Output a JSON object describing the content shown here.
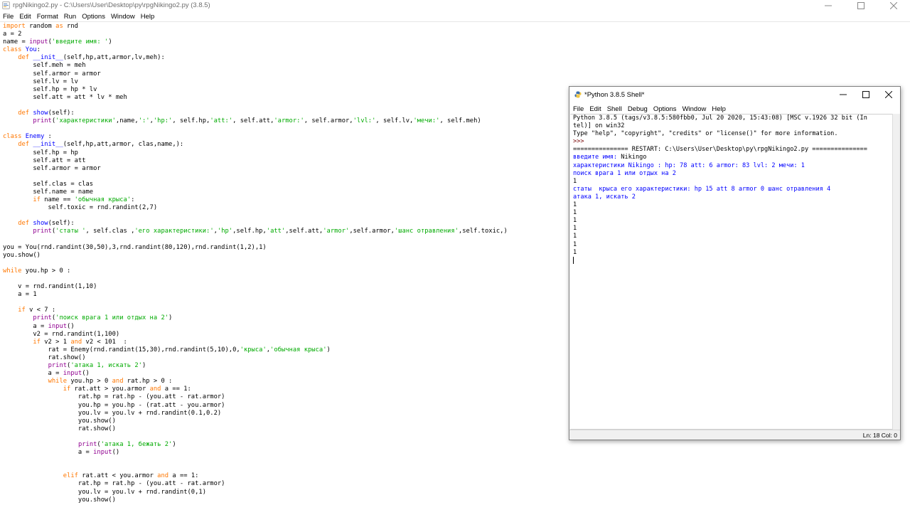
{
  "editor_window": {
    "title": "rpgNikingo2.py - C:\\Users\\User\\Desktop\\py\\rpgNikingo2.py (3.8.5)",
    "menu": [
      "File",
      "Edit",
      "Format",
      "Run",
      "Options",
      "Window",
      "Help"
    ],
    "code": [
      [
        [
          "kw",
          "import"
        ],
        [
          "t",
          " random "
        ],
        [
          "kw",
          "as"
        ],
        [
          "t",
          " rnd"
        ]
      ],
      [
        [
          "t",
          "a = 2"
        ]
      ],
      [
        [
          "t",
          "name = "
        ],
        [
          "bi",
          "input"
        ],
        [
          "t",
          "("
        ],
        [
          "st",
          "'введите имя: '"
        ],
        [
          "t",
          ")"
        ]
      ],
      [
        [
          "kw",
          "class"
        ],
        [
          "t",
          " "
        ],
        [
          "df",
          "You"
        ],
        [
          "t",
          ":"
        ]
      ],
      [
        [
          "t",
          "    "
        ],
        [
          "kw",
          "def"
        ],
        [
          "t",
          " "
        ],
        [
          "df",
          "__init__"
        ],
        [
          "t",
          "(self,hp,att,armor,lv,meh):"
        ]
      ],
      [
        [
          "t",
          "        self.meh = meh"
        ]
      ],
      [
        [
          "t",
          "        self.armor = armor"
        ]
      ],
      [
        [
          "t",
          "        self.lv = lv"
        ]
      ],
      [
        [
          "t",
          "        self.hp = hp * lv"
        ]
      ],
      [
        [
          "t",
          "        self.att = att * lv * meh"
        ]
      ],
      [
        [
          "t",
          ""
        ]
      ],
      [
        [
          "t",
          "    "
        ],
        [
          "kw",
          "def"
        ],
        [
          "t",
          " "
        ],
        [
          "df",
          "show"
        ],
        [
          "t",
          "(self):"
        ]
      ],
      [
        [
          "t",
          "        "
        ],
        [
          "bi",
          "print"
        ],
        [
          "t",
          "("
        ],
        [
          "st",
          "'характеристики'"
        ],
        [
          "t",
          ",name,"
        ],
        [
          "st",
          "':'"
        ],
        [
          "t",
          ","
        ],
        [
          "st",
          "'hp:'"
        ],
        [
          "t",
          ", self.hp,"
        ],
        [
          "st",
          "'att:'"
        ],
        [
          "t",
          ", self.att,"
        ],
        [
          "st",
          "'armor:'"
        ],
        [
          "t",
          ", self.armor,"
        ],
        [
          "st",
          "'lvl:'"
        ],
        [
          "t",
          ", self.lv,"
        ],
        [
          "st",
          "'мечи:'"
        ],
        [
          "t",
          ", self.meh)"
        ]
      ],
      [
        [
          "t",
          ""
        ]
      ],
      [
        [
          "kw",
          "class"
        ],
        [
          "t",
          " "
        ],
        [
          "df",
          "Enemy"
        ],
        [
          "t",
          " :"
        ]
      ],
      [
        [
          "t",
          "    "
        ],
        [
          "kw",
          "def"
        ],
        [
          "t",
          " "
        ],
        [
          "df",
          "__init__"
        ],
        [
          "t",
          "(self,hp,att,armor, clas,name,):"
        ]
      ],
      [
        [
          "t",
          "        self.hp = hp"
        ]
      ],
      [
        [
          "t",
          "        self.att = att"
        ]
      ],
      [
        [
          "t",
          "        self.armor = armor"
        ]
      ],
      [
        [
          "t",
          ""
        ]
      ],
      [
        [
          "t",
          "        self.clas = clas"
        ]
      ],
      [
        [
          "t",
          "        self.name = name"
        ]
      ],
      [
        [
          "t",
          "        "
        ],
        [
          "kw",
          "if"
        ],
        [
          "t",
          " name == "
        ],
        [
          "st",
          "'обычная крыса'"
        ],
        [
          "t",
          ":"
        ]
      ],
      [
        [
          "t",
          "            self.toxic = rnd.randint(2,7)"
        ]
      ],
      [
        [
          "t",
          ""
        ]
      ],
      [
        [
          "t",
          "    "
        ],
        [
          "kw",
          "def"
        ],
        [
          "t",
          " "
        ],
        [
          "df",
          "show"
        ],
        [
          "t",
          "(self):"
        ]
      ],
      [
        [
          "t",
          "        "
        ],
        [
          "bi",
          "print"
        ],
        [
          "t",
          "("
        ],
        [
          "st",
          "'статы '"
        ],
        [
          "t",
          ", self.clas ,"
        ],
        [
          "st",
          "'его характеристики:'"
        ],
        [
          "t",
          ","
        ],
        [
          "st",
          "'hp'"
        ],
        [
          "t",
          ",self.hp,"
        ],
        [
          "st",
          "'att'"
        ],
        [
          "t",
          ",self.att,"
        ],
        [
          "st",
          "'armor'"
        ],
        [
          "t",
          ",self.armor,"
        ],
        [
          "st",
          "'шанс отравления'"
        ],
        [
          "t",
          ",self.toxic,)"
        ]
      ],
      [
        [
          "t",
          ""
        ]
      ],
      [
        [
          "t",
          "you = You(rnd.randint(30,50),3,rnd.randint(80,120),rnd.randint(1,2),1)"
        ]
      ],
      [
        [
          "t",
          "you.show()"
        ]
      ],
      [
        [
          "t",
          ""
        ]
      ],
      [
        [
          "kw",
          "while"
        ],
        [
          "t",
          " you.hp > 0 :"
        ]
      ],
      [
        [
          "t",
          ""
        ]
      ],
      [
        [
          "t",
          "    v = rnd.randint(1,10)"
        ]
      ],
      [
        [
          "t",
          "    a = 1"
        ]
      ],
      [
        [
          "t",
          ""
        ]
      ],
      [
        [
          "t",
          "    "
        ],
        [
          "kw",
          "if"
        ],
        [
          "t",
          " v < 7 :"
        ]
      ],
      [
        [
          "t",
          "        "
        ],
        [
          "bi",
          "print"
        ],
        [
          "t",
          "("
        ],
        [
          "st",
          "'поиск врага 1 или отдых на 2'"
        ],
        [
          "t",
          ")"
        ]
      ],
      [
        [
          "t",
          "        a = "
        ],
        [
          "bi",
          "input"
        ],
        [
          "t",
          "()"
        ]
      ],
      [
        [
          "t",
          "        v2 = rnd.randint(1,100)"
        ]
      ],
      [
        [
          "t",
          "        "
        ],
        [
          "kw",
          "if"
        ],
        [
          "t",
          " v2 > 1 "
        ],
        [
          "kw",
          "and"
        ],
        [
          "t",
          " v2 < 101  :"
        ]
      ],
      [
        [
          "t",
          "            rat = Enemy(rnd.randint(15,30),rnd.randint(5,10),0,"
        ],
        [
          "st",
          "'крыса'"
        ],
        [
          "t",
          ","
        ],
        [
          "st",
          "'обычная крыса'"
        ],
        [
          "t",
          ")"
        ]
      ],
      [
        [
          "t",
          "            rat.show()"
        ]
      ],
      [
        [
          "t",
          "            "
        ],
        [
          "bi",
          "print"
        ],
        [
          "t",
          "("
        ],
        [
          "st",
          "'атака 1, искать 2'"
        ],
        [
          "t",
          ")"
        ]
      ],
      [
        [
          "t",
          "            a = "
        ],
        [
          "bi",
          "input"
        ],
        [
          "t",
          "()"
        ]
      ],
      [
        [
          "t",
          "            "
        ],
        [
          "kw",
          "while"
        ],
        [
          "t",
          " you.hp > 0 "
        ],
        [
          "kw",
          "and"
        ],
        [
          "t",
          " rat.hp > 0 :"
        ]
      ],
      [
        [
          "t",
          "                "
        ],
        [
          "kw",
          "if"
        ],
        [
          "t",
          " rat.att > you.armor "
        ],
        [
          "kw",
          "and"
        ],
        [
          "t",
          " a == 1:"
        ]
      ],
      [
        [
          "t",
          "                    rat.hp = rat.hp - (you.att - rat.armor)"
        ]
      ],
      [
        [
          "t",
          "                    you.hp = you.hp - (rat.att - you.armor)"
        ]
      ],
      [
        [
          "t",
          "                    you.lv = you.lv + rnd.randint(0.1,0.2)"
        ]
      ],
      [
        [
          "t",
          "                    you.show()"
        ]
      ],
      [
        [
          "t",
          "                    rat.show()"
        ]
      ],
      [
        [
          "t",
          ""
        ]
      ],
      [
        [
          "t",
          "                    "
        ],
        [
          "bi",
          "print"
        ],
        [
          "t",
          "("
        ],
        [
          "st",
          "'атака 1, бежать 2'"
        ],
        [
          "t",
          ")"
        ]
      ],
      [
        [
          "t",
          "                    a = "
        ],
        [
          "bi",
          "input"
        ],
        [
          "t",
          "()"
        ]
      ],
      [
        [
          "t",
          ""
        ]
      ],
      [
        [
          "t",
          ""
        ]
      ],
      [
        [
          "t",
          "                "
        ],
        [
          "kw",
          "elif"
        ],
        [
          "t",
          " rat.att < you.armor "
        ],
        [
          "kw",
          "and"
        ],
        [
          "t",
          " a == 1:"
        ]
      ],
      [
        [
          "t",
          "                    rat.hp = rat.hp - (you.att - rat.armor)"
        ]
      ],
      [
        [
          "t",
          "                    you.lv = you.lv + rnd.randint(0,1)"
        ]
      ],
      [
        [
          "t",
          "                    you.show()"
        ]
      ]
    ]
  },
  "shell_window": {
    "title": "*Python 3.8.5 Shell*",
    "menu": [
      "File",
      "Edit",
      "Shell",
      "Debug",
      "Options",
      "Window",
      "Help"
    ],
    "lines": [
      [
        [
          "plain",
          "Python 3.8.5 (tags/v3.8.5:580fbb0, Jul 20 2020, 15:43:08) [MSC v.1926 32 bit (In"
        ]
      ],
      [
        [
          "plain",
          "tel)] on win32"
        ]
      ],
      [
        [
          "plain",
          "Type \"help\", \"copyright\", \"credits\" or \"license()\" for more information."
        ]
      ],
      [
        [
          "prompt",
          ">>> "
        ]
      ],
      [
        [
          "restart",
          "=============== RESTART: C:\\Users\\User\\Desktop\\py\\rpgNikingo2.py ==============="
        ]
      ],
      [
        [
          "out",
          "введите имя: "
        ],
        [
          "plain",
          "Nikingo"
        ]
      ],
      [
        [
          "out",
          "характеристики Nikingo : hp: 78 att: 6 armor: 83 lvl: 2 мечи: 1"
        ]
      ],
      [
        [
          "out",
          "поиск врага 1 или отдых на 2"
        ]
      ],
      [
        [
          "plain",
          "1"
        ]
      ],
      [
        [
          "out",
          "статы  крыса его характеристики: hp 15 att 8 armor 0 шанс отравления 4"
        ]
      ],
      [
        [
          "out",
          "атака 1, искать 2"
        ]
      ],
      [
        [
          "plain",
          "1"
        ]
      ],
      [
        [
          "plain",
          "1"
        ]
      ],
      [
        [
          "plain",
          "1"
        ]
      ],
      [
        [
          "plain",
          "1"
        ]
      ],
      [
        [
          "plain",
          "1"
        ]
      ],
      [
        [
          "plain",
          "1"
        ]
      ],
      [
        [
          "plain",
          "1"
        ]
      ]
    ],
    "status": "Ln: 18   Col: 0"
  },
  "colors": {
    "keyword": "#ff7700",
    "builtin": "#900090",
    "string": "#00aa00",
    "definition": "#0000ff",
    "stdout": "#0000ff"
  }
}
